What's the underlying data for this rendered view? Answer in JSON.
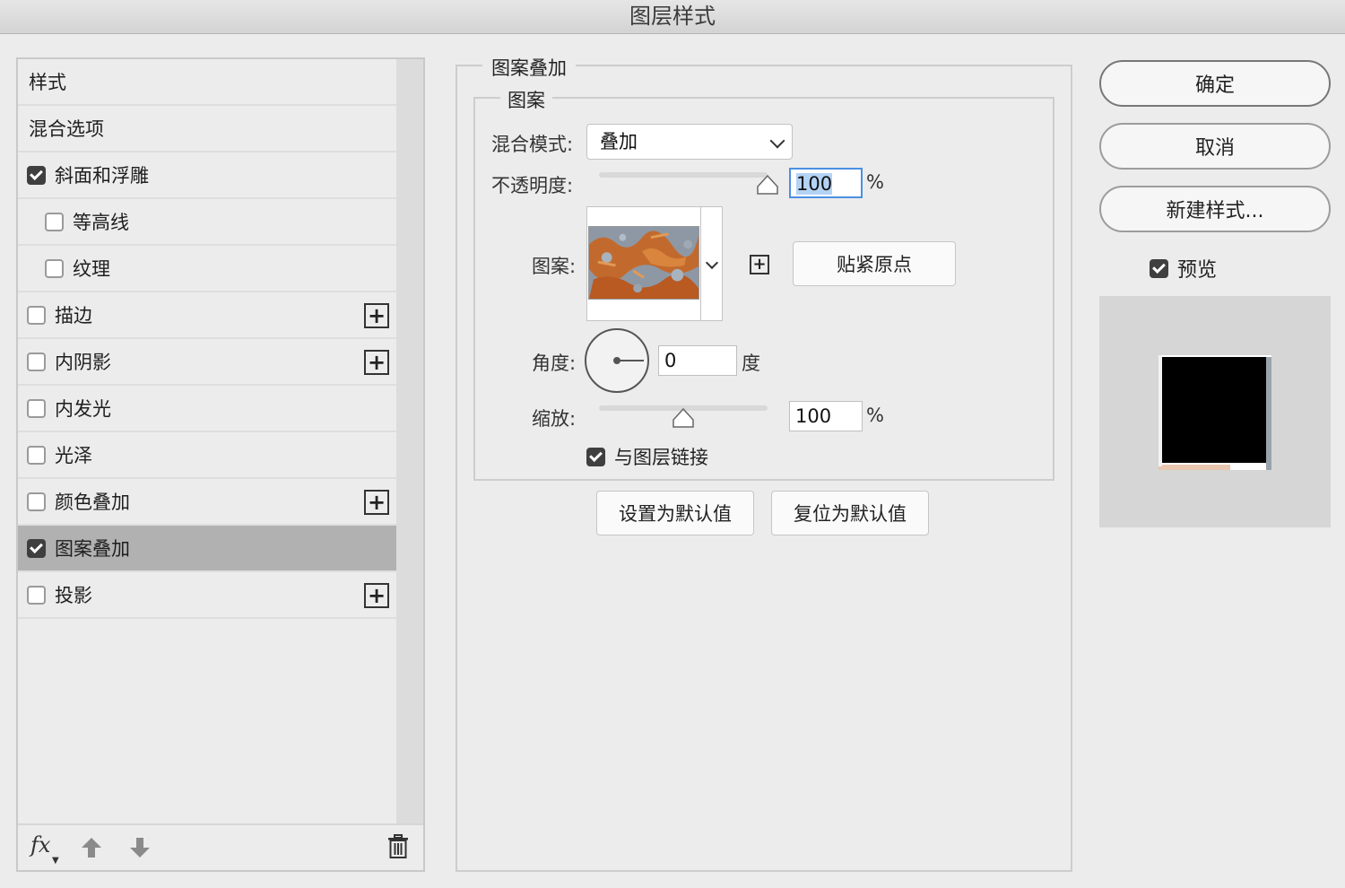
{
  "window": {
    "title": "图层样式"
  },
  "styles_panel": {
    "items": [
      {
        "label": "样式",
        "checkbox": false,
        "checked": false,
        "indent": 0,
        "add_button": false,
        "selected": false
      },
      {
        "label": "混合选项",
        "checkbox": false,
        "checked": false,
        "indent": 0,
        "add_button": false,
        "selected": false
      },
      {
        "label": "斜面和浮雕",
        "checkbox": true,
        "checked": true,
        "indent": 0,
        "add_button": false,
        "selected": false
      },
      {
        "label": "等高线",
        "checkbox": true,
        "checked": false,
        "indent": 1,
        "add_button": false,
        "selected": false
      },
      {
        "label": "纹理",
        "checkbox": true,
        "checked": false,
        "indent": 1,
        "add_button": false,
        "selected": false
      },
      {
        "label": "描边",
        "checkbox": true,
        "checked": false,
        "indent": 0,
        "add_button": true,
        "selected": false
      },
      {
        "label": "内阴影",
        "checkbox": true,
        "checked": false,
        "indent": 0,
        "add_button": true,
        "selected": false
      },
      {
        "label": "内发光",
        "checkbox": true,
        "checked": false,
        "indent": 0,
        "add_button": false,
        "selected": false
      },
      {
        "label": "光泽",
        "checkbox": true,
        "checked": false,
        "indent": 0,
        "add_button": false,
        "selected": false
      },
      {
        "label": "颜色叠加",
        "checkbox": true,
        "checked": false,
        "indent": 0,
        "add_button": true,
        "selected": false
      },
      {
        "label": "图案叠加",
        "checkbox": true,
        "checked": true,
        "indent": 0,
        "add_button": false,
        "selected": true
      },
      {
        "label": "投影",
        "checkbox": true,
        "checked": false,
        "indent": 0,
        "add_button": true,
        "selected": false
      }
    ],
    "bottom": {
      "fx_label": "fx",
      "icons": [
        "fx-icon",
        "move-up-icon",
        "move-down-icon",
        "trash-icon"
      ]
    }
  },
  "pattern_overlay": {
    "group_title": "图案叠加",
    "subgroup_title": "图案",
    "blend_mode_label": "混合模式:",
    "blend_mode_value": "叠加",
    "opacity_label": "不透明度:",
    "opacity_value": "100",
    "opacity_unit": "%",
    "opacity_slider_level": 1.0,
    "pattern_label": "图案:",
    "snap_button": "贴紧原点",
    "angle_label": "角度:",
    "angle_value": "0",
    "angle_unit": "度",
    "scale_label": "缩放:",
    "scale_value": "100",
    "scale_unit": "%",
    "scale_slider_level": 0.5,
    "link_label": "与图层链接",
    "link_checked": true,
    "set_default_button": "设置为默认值",
    "reset_default_button": "复位为默认值"
  },
  "actions": {
    "ok": "确定",
    "cancel": "取消",
    "new_style": "新建样式...",
    "preview_label": "预览",
    "preview_checked": true
  },
  "colors": {
    "selected_row": "#b1b1b1",
    "focus_ring": "#4a90e2",
    "checkbox_on": "#3f3f3f"
  }
}
